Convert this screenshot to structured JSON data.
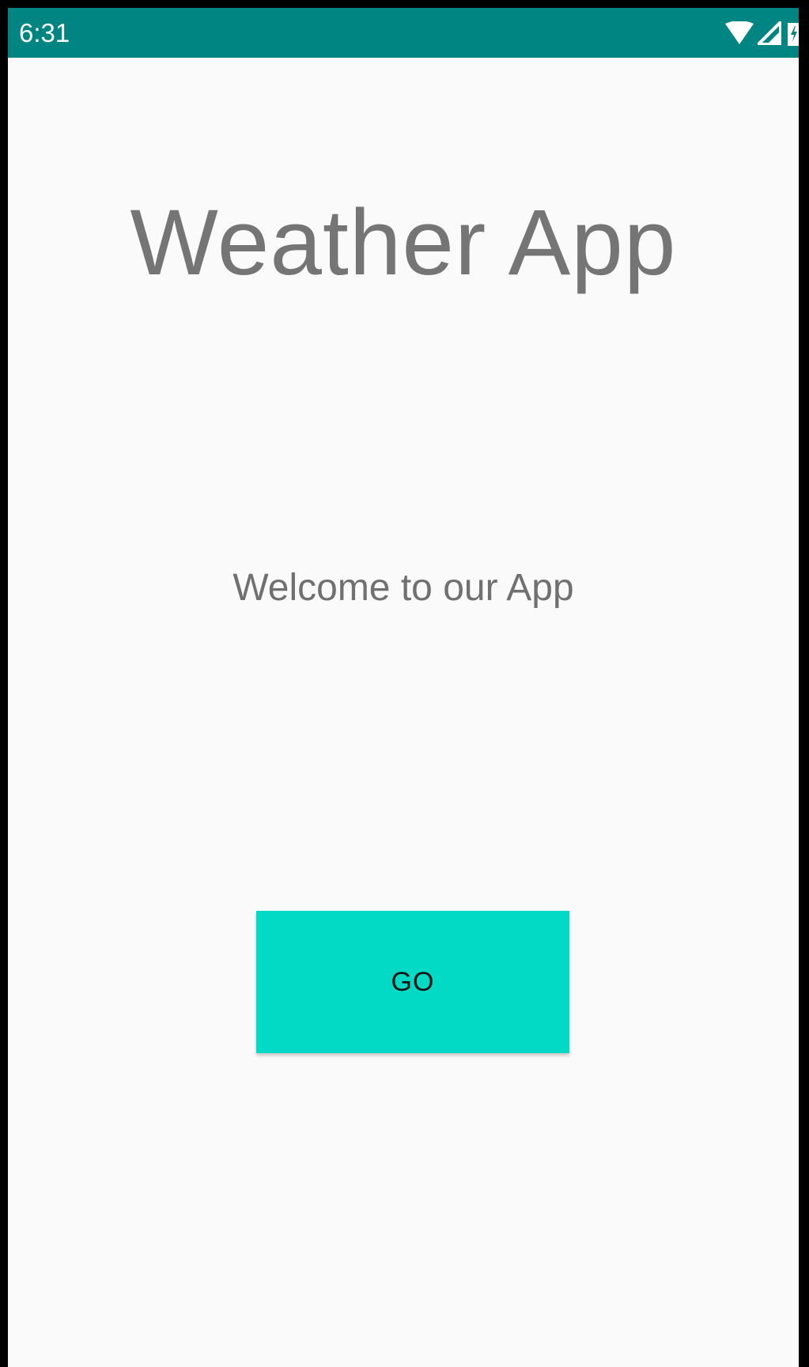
{
  "status_bar": {
    "time": "6:31",
    "icons": [
      "wifi-icon",
      "cellular-signal-icon",
      "battery-charging-icon"
    ],
    "background_color": "#008582"
  },
  "main": {
    "title": "Weather App",
    "welcome": "Welcome to our App",
    "go_button_label": "GO",
    "go_button_color": "#03dac5"
  }
}
